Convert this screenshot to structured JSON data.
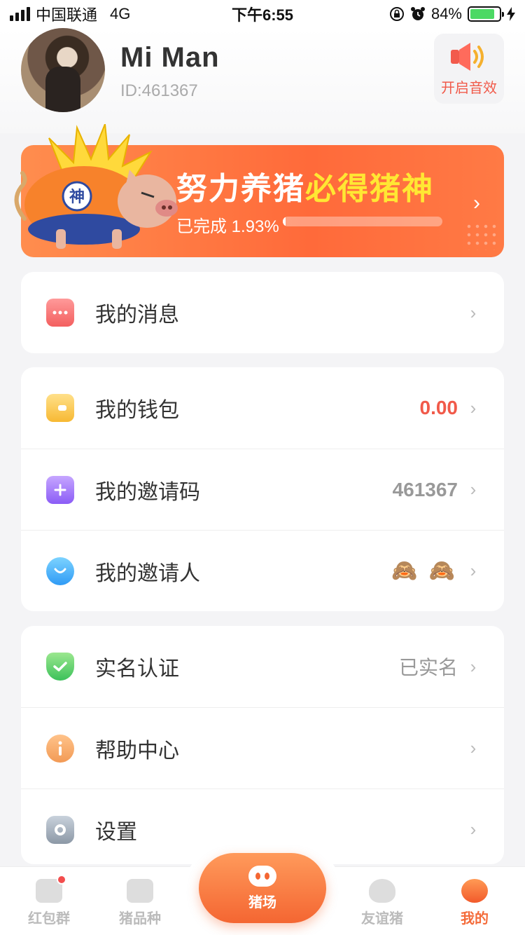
{
  "status_bar": {
    "carrier": "中国联通",
    "network": "4G",
    "time": "下午6:55",
    "battery": "84%",
    "battery_level": 0.84
  },
  "profile": {
    "name": "Mi Man",
    "id_text": "ID:461367",
    "sound_label": "开启音效"
  },
  "banner": {
    "title_main": "努力养猪",
    "title_highlight": "必得猪神",
    "progress_label": "已完成 1.93%",
    "progress": 0.0193,
    "pig_badge": "神"
  },
  "menu": {
    "messages": {
      "label": "我的消息"
    },
    "wallet": {
      "label": "我的钱包",
      "value": "0.00"
    },
    "invite_code": {
      "label": "我的邀请码",
      "value": "461367"
    },
    "inviter": {
      "label": "我的邀请人",
      "value": "🙈 🙈"
    },
    "real_name": {
      "label": "实名认证",
      "value": "已实名"
    },
    "help": {
      "label": "帮助中心"
    },
    "settings": {
      "label": "设置"
    }
  },
  "tabs": [
    {
      "label": "红包群"
    },
    {
      "label": "猪品种"
    },
    {
      "label": "猪场"
    },
    {
      "label": "友谊猪"
    },
    {
      "label": "我的"
    }
  ],
  "colors": {
    "accent": "#f46c3b",
    "wallet_value": "#f15a4a",
    "muted_value": "#999999"
  }
}
